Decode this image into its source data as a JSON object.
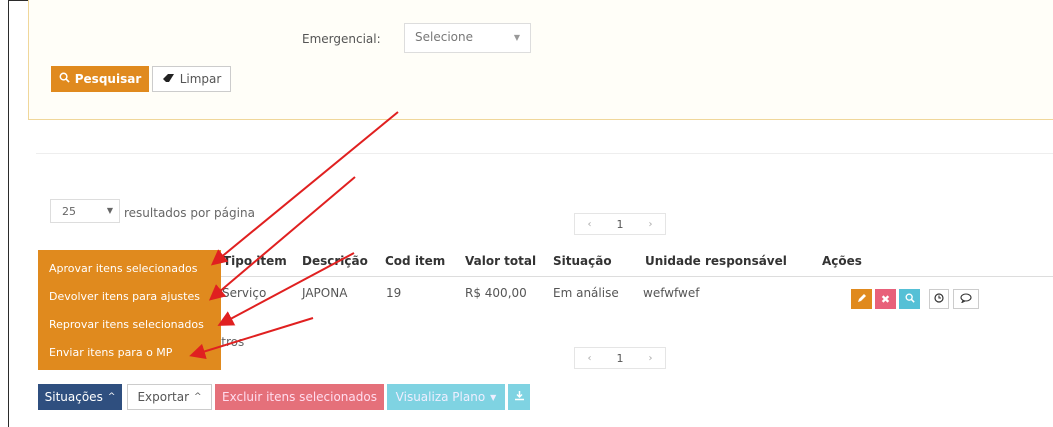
{
  "filter": {
    "emergencial_label": "Emergencial:",
    "emergencial_value": "Selecione",
    "search_label": "Pesquisar",
    "clear_label": "Limpar"
  },
  "pagination": {
    "per_page": "25",
    "per_page_label": "resultados por página",
    "current_page": "1",
    "prev": "‹",
    "next": "›"
  },
  "table": {
    "headers": [
      "Tipo item",
      "Descrição",
      "Cod item",
      "Valor total",
      "Situação",
      "Unidade responsável",
      "Ações"
    ],
    "rows": [
      [
        "Serviço",
        "JAPONA",
        "19",
        "R$ 400,00",
        "Em análise",
        "wefwfwef"
      ]
    ],
    "footer_text": "stros"
  },
  "situacoes_menu": [
    "Aprovar itens selecionados",
    "Devolver itens para ajustes",
    "Reprovar itens selecionados",
    "Enviar itens para o MP"
  ],
  "bottom_bar": {
    "situacoes_label": "Situações",
    "exportar_label": "Exportar",
    "excluir_label": "Excluir itens selecionados",
    "visualiza_label": "Visualiza Plano"
  },
  "colors": {
    "accent_orange": "#e08a1e",
    "navy": "#2f4f7f",
    "danger": "#e8607a",
    "info": "#55c0d6",
    "annotation_red": "#e02020"
  },
  "icons": {
    "search": "search-icon",
    "eraser": "eraser-icon",
    "caret": "caret-down-icon",
    "edit": "pencil-icon",
    "delete": "close-icon",
    "view": "search-icon",
    "history": "clock-icon",
    "comment": "comment-icon",
    "download": "download-icon"
  }
}
